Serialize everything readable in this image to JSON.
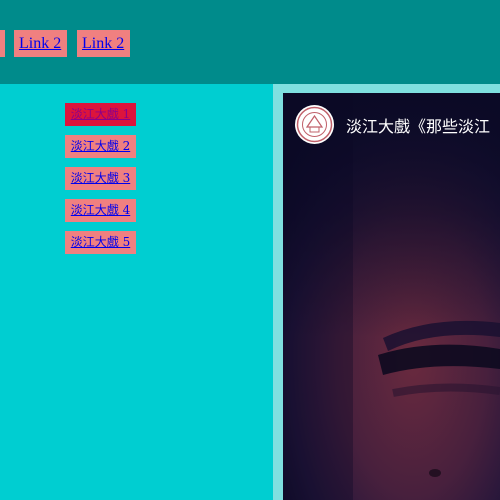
{
  "topnav": {
    "links": [
      "",
      "Link 2",
      "Link 2"
    ]
  },
  "sidebar": {
    "items": [
      {
        "label": "淡江大戲 1",
        "active": true
      },
      {
        "label": "淡江大戲 2",
        "active": false
      },
      {
        "label": "淡江大戲 3",
        "active": false
      },
      {
        "label": "淡江大戲 4",
        "active": false
      },
      {
        "label": "淡江大戲 5",
        "active": false
      }
    ]
  },
  "video": {
    "title": "淡江大戲《那些淡江",
    "channel_logo_icon": "university-seal-icon"
  },
  "colors": {
    "topbar": "#008B8B",
    "page_bg": "#00CED1",
    "link_bg": "#F08080",
    "active_bg": "#DC143C",
    "content_bg": "#7FE0E0"
  }
}
